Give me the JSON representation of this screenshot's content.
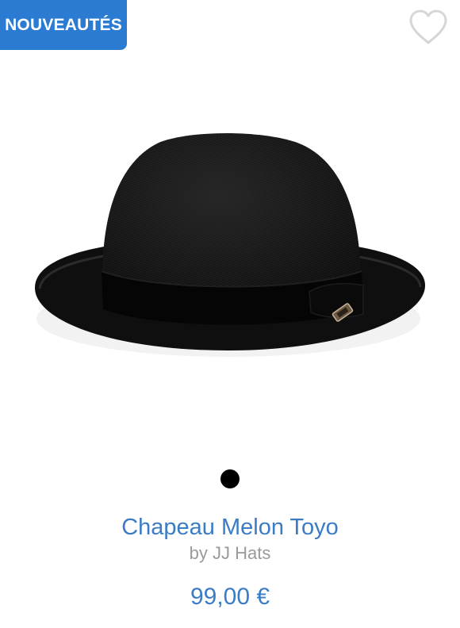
{
  "badge": {
    "label": "NOUVEAUTÉS",
    "color": "#2b7bd3"
  },
  "wishlist": {
    "icon": "heart-outline-icon"
  },
  "product": {
    "title": "Chapeau Melon Toyo",
    "brand": "by JJ Hats",
    "price": "99,00 €",
    "image": "black-bowler-hat"
  },
  "carousel": {
    "dot_count": 1,
    "active_index": 0
  },
  "colors": {
    "title": "#3b7cc4",
    "price": "#3b7cc4",
    "brand": "#9a9a9a"
  }
}
